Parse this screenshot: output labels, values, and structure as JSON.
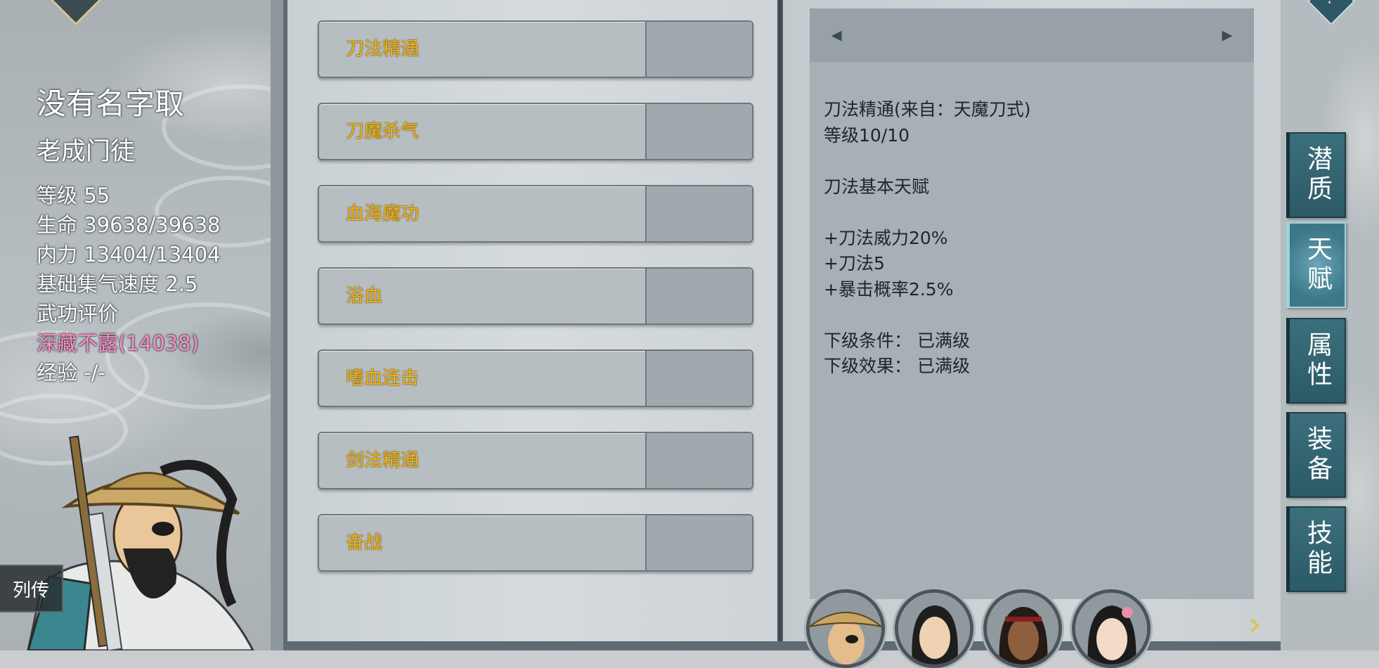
{
  "character": {
    "name": "没有名字取",
    "title": "老成门徒",
    "level": "等级 55",
    "hp": "生命 39638/39638",
    "mp": "内力 13404/13404",
    "qi_speed": "基础集气速度 2.5",
    "rating_label": "武功评价",
    "rating_value": "深藏不露(14038)",
    "exp": "经验 -/-",
    "bio_button": "列传"
  },
  "talents": [
    {
      "name": "刀法精通"
    },
    {
      "name": "刀魔杀气"
    },
    {
      "name": "血海魔功"
    },
    {
      "name": "浴血"
    },
    {
      "name": "嗜血连击"
    },
    {
      "name": "剑法精通"
    },
    {
      "name": "奋战"
    }
  ],
  "detail": {
    "lines": [
      "刀法精通(来自：天魔刀式)",
      "等级10/10",
      "",
      "刀法基本天赋",
      "",
      "+刀法威力20%",
      "+刀法5",
      "+暴击概率2.5%",
      "",
      "下级条件：  已满级",
      "下级效果：  已满级"
    ],
    "prev_icon": "◂",
    "next_icon": "▸"
  },
  "tabs": [
    {
      "label": "潜质",
      "active": false
    },
    {
      "label": "天赋",
      "active": true
    },
    {
      "label": "属性",
      "active": false
    },
    {
      "label": "装备",
      "active": false
    },
    {
      "label": "技能",
      "active": false
    }
  ],
  "help_icon": "?",
  "party_next_icon": "›",
  "colors": {
    "talent_label": "#f5b312",
    "rating_value": "#ff8fc8",
    "tab_bg": "#2c5a67"
  }
}
